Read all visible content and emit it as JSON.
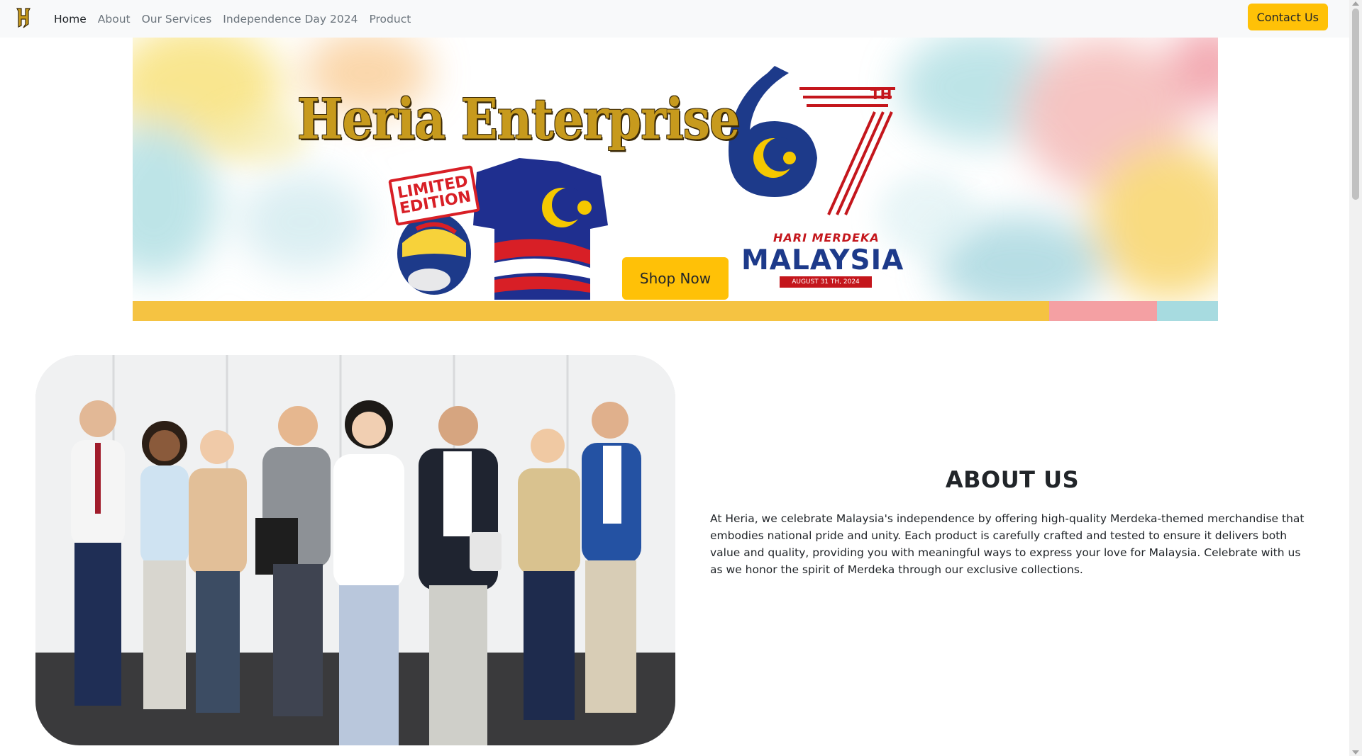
{
  "navbar": {
    "brand_icon": "heria-h-logo",
    "links": [
      {
        "label": "Home",
        "active": true
      },
      {
        "label": "About",
        "active": false
      },
      {
        "label": "Our Services",
        "active": false
      },
      {
        "label": "Independence Day 2024",
        "active": false
      },
      {
        "label": "Product",
        "active": false
      }
    ],
    "contact_label": "Contact Us"
  },
  "banner": {
    "brand_title": "Heria Enterprise",
    "badge_text": "LIMITED EDITION",
    "shop_label": "Shop Now",
    "anniversary_number": "67",
    "anniversary_suffix": "TH",
    "hari_merdeka": "HARI MERDEKA",
    "country": "MALAYSIA",
    "date_ribbon": "AUGUST 31 TH, 2024"
  },
  "about": {
    "heading": "ABOUT US",
    "body": "At Heria, we celebrate Malaysia's independence by offering high-quality Merdeka-themed merchandise that embodies national pride and unity. Each product is carefully crafted and tested to ensure it delivers both value and quality, providing you with meaningful ways to express your love for Malaysia. Celebrate with us as we honor the spirit of Merdeka through our exclusive collections."
  },
  "colors": {
    "accent": "#ffc107",
    "navbar_bg": "#f8f9fa",
    "nav_text": "#6c757d",
    "stripe_yellow": "#f5c342",
    "stripe_pink": "#f4a0a3",
    "stripe_blue": "#a7dbe0",
    "merdeka_blue": "#1d3a8a",
    "merdeka_red": "#c4161c"
  }
}
